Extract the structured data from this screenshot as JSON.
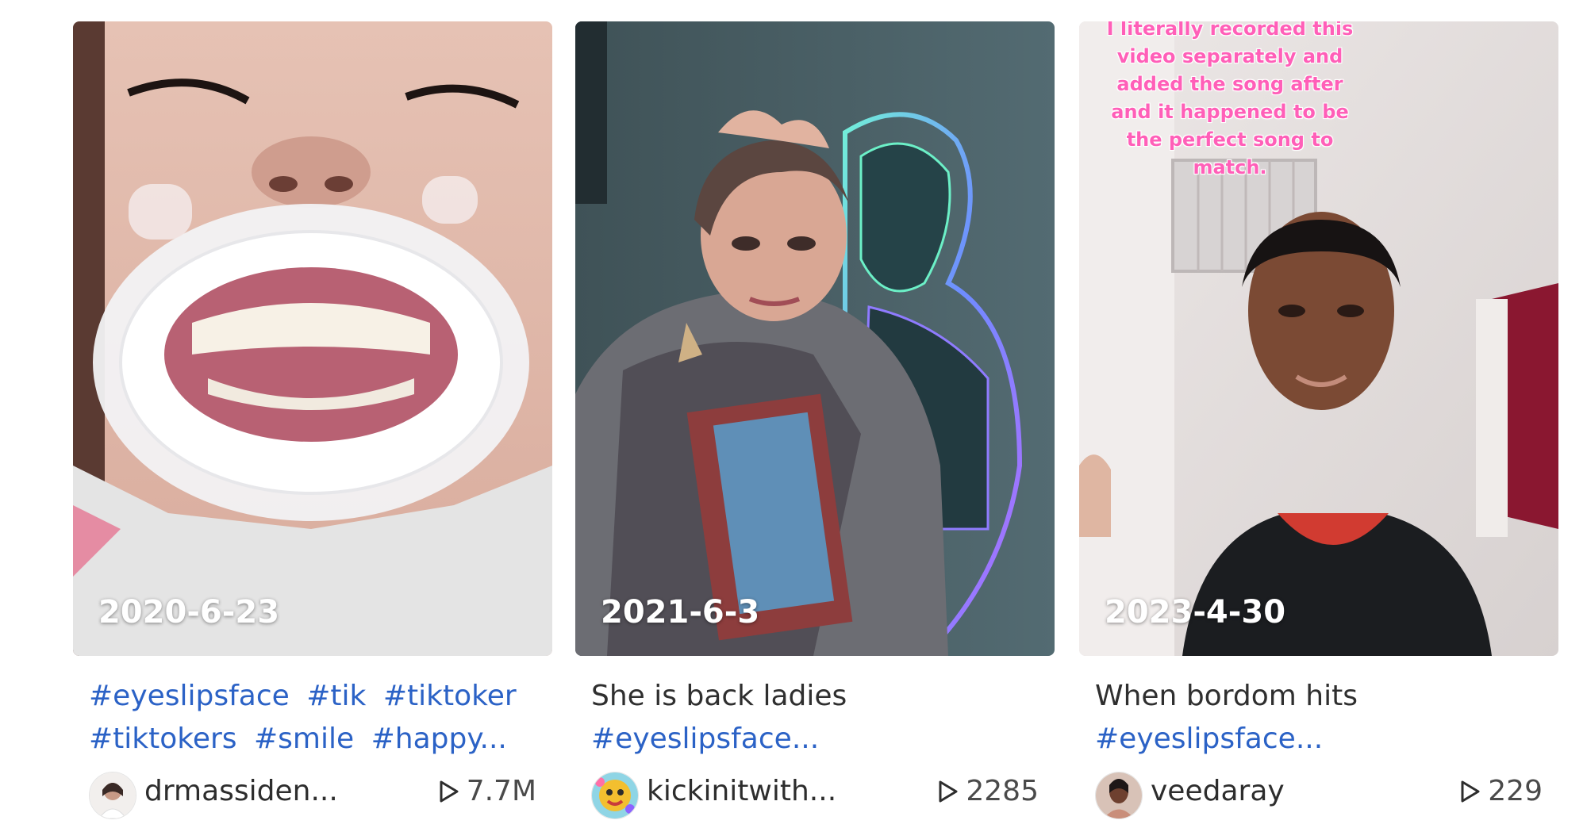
{
  "cards": [
    {
      "date": "2020-6-23",
      "desc_line1_text": "",
      "desc_line1_tags": [
        "#eyeslipsface",
        "#tik",
        "#tiktoker"
      ],
      "desc_line2_tags": [
        "#tiktokers",
        "#smile",
        "#happy"
      ],
      "ellipsis": "...",
      "author": "drmassiden...",
      "plays": "7.7M"
    },
    {
      "date": "2021-6-3",
      "desc_line1_text": "She is back ladies",
      "desc_line2_tags": [
        "#eyeslipsface"
      ],
      "ellipsis": "...",
      "author": "kickinitwith...",
      "plays": "2285"
    },
    {
      "date": "2023-4-30",
      "overlay_caption": "I literally recorded this video separately and added the song after and it happened to be the perfect song to match.",
      "desc_line1_text": "When bordom hits",
      "desc_line2_tags": [
        "#eyeslipsface"
      ],
      "ellipsis": "...",
      "author": "veedaray",
      "plays": "229"
    }
  ],
  "icons": {
    "play": "play-outline-icon"
  },
  "colors": {
    "hashtag": "#2b62c6",
    "text": "#2f2f2f"
  }
}
